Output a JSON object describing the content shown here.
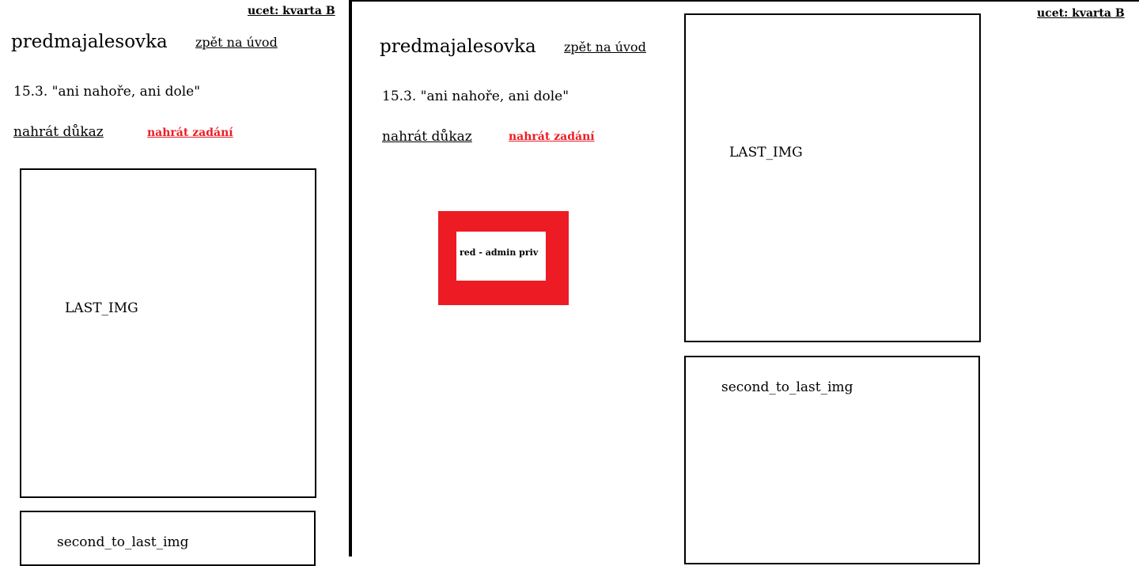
{
  "account": {
    "label": "ucet: kvarta B"
  },
  "header": {
    "title": "predmajalesovka",
    "back_link": "zpět na úvod"
  },
  "event": {
    "date_title": "15.3. \"ani nahoře, ani dole\""
  },
  "actions": {
    "upload_proof": "nahrát důkaz",
    "upload_task": "nahrát zadání"
  },
  "images": {
    "last": "LAST_IMG",
    "second_to_last": "second_to_last_img"
  },
  "admin_note": {
    "text": "red - admin priv"
  },
  "colors": {
    "admin_red": "#ed1c24",
    "border": "#000000",
    "background": "#ffffff"
  }
}
